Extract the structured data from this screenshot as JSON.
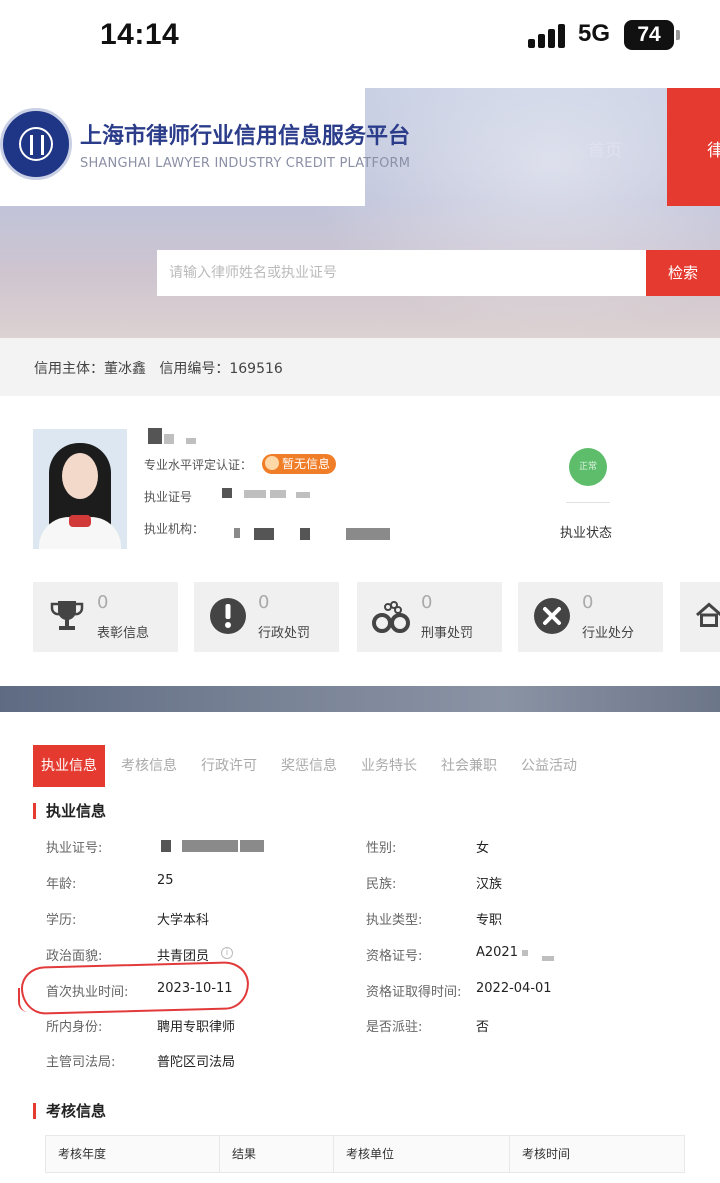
{
  "status_bar": {
    "time": "14:14",
    "network": "5G",
    "battery": "74"
  },
  "header": {
    "site_title": "上海市律师行业信用信息服务平台",
    "site_subtitle": "SHANGHAI LAWYER INDUSTRY CREDIT PLATFORM",
    "nav_home": "首页",
    "nav_active": "律",
    "search_placeholder": "请输入律师姓名或执业证号",
    "search_button": "检索"
  },
  "credit": {
    "subject_label": "信用主体：",
    "subject_name": "董冰鑫",
    "number_label": "信用编号：",
    "number_value": "169516"
  },
  "profile": {
    "cert_label": "专业水平评定认证：",
    "cert_badge": "暂无信息",
    "license_label": "执业证号",
    "firm_label": "执业机构：",
    "status_badge": "正常",
    "status_label": "执业状态"
  },
  "stats": [
    {
      "icon": "trophy-icon",
      "count": "0",
      "label": "表彰信息"
    },
    {
      "icon": "exclamation-icon",
      "count": "0",
      "label": "行政处罚"
    },
    {
      "icon": "handcuffs-icon",
      "count": "0",
      "label": "刑事处罚"
    },
    {
      "icon": "close-circle-icon",
      "count": "0",
      "label": "行业处分"
    }
  ],
  "tabs": [
    "执业信息",
    "考核信息",
    "行政许可",
    "奖惩信息",
    "业务特长",
    "社会兼职",
    "公益活动"
  ],
  "practice": {
    "heading": "执业信息",
    "left": [
      {
        "label": "执业证号:",
        "value": ""
      },
      {
        "label": "年龄:",
        "value": "25"
      },
      {
        "label": "学历:",
        "value": "大学本科"
      },
      {
        "label": "政治面貌:",
        "value": "共青团员"
      },
      {
        "label": "首次执业时间:",
        "value": "2023-10-11"
      },
      {
        "label": "所内身份:",
        "value": "聘用专职律师"
      },
      {
        "label": "主管司法局:",
        "value": "普陀区司法局"
      }
    ],
    "right": [
      {
        "label": "性别:",
        "value": "女"
      },
      {
        "label": "民族:",
        "value": "汉族"
      },
      {
        "label": "执业类型:",
        "value": "专职"
      },
      {
        "label": "资格证号:",
        "value": "A2021"
      },
      {
        "label": "资格证取得时间:",
        "value": "2022-04-01"
      },
      {
        "label": "是否派驻:",
        "value": "否"
      }
    ]
  },
  "assessment": {
    "heading": "考核信息",
    "columns": [
      "考核年度",
      "结果",
      "考核单位",
      "考核时间"
    ]
  },
  "colors": {
    "accent_red": "#e53a2f",
    "brand_blue": "#2b3c8a",
    "status_green": "#5ebd6b",
    "badge_orange": "#f07d28"
  }
}
